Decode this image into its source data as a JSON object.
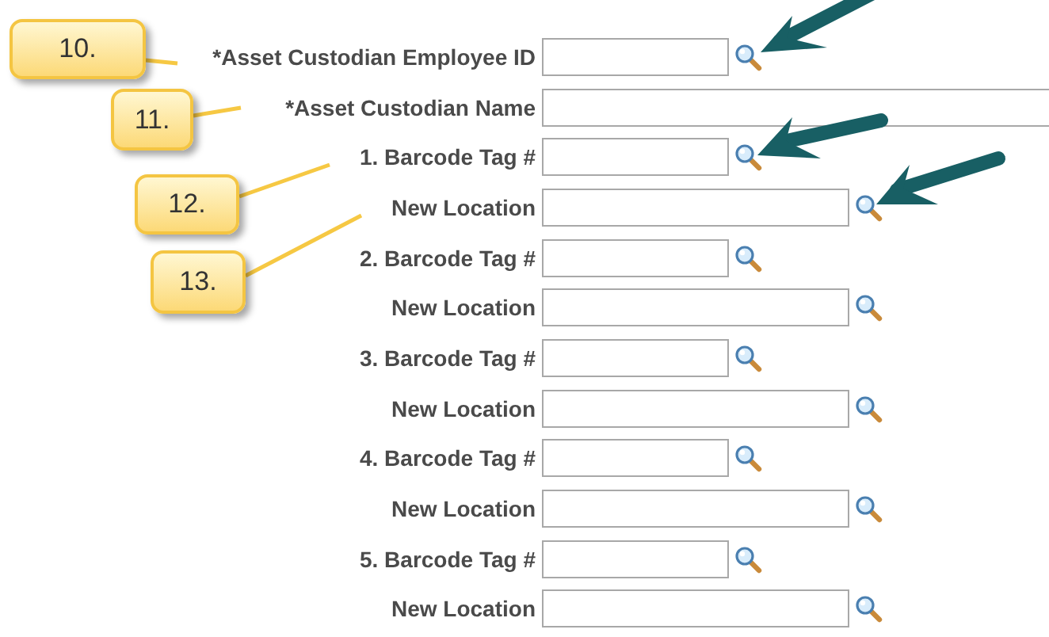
{
  "form": {
    "rows": [
      {
        "label": "*Asset Custodian Employee ID",
        "kind": "short",
        "lookup": true
      },
      {
        "label": "*Asset Custodian Name",
        "kind": "wide",
        "lookup": false
      },
      {
        "label": "1. Barcode Tag #",
        "kind": "short",
        "lookup": true
      },
      {
        "label": "New Location",
        "kind": "long",
        "lookup": true
      },
      {
        "label": "2. Barcode Tag #",
        "kind": "short",
        "lookup": true
      },
      {
        "label": "New Location",
        "kind": "long",
        "lookup": true
      },
      {
        "label": "3. Barcode Tag #",
        "kind": "short",
        "lookup": true
      },
      {
        "label": "New Location",
        "kind": "long",
        "lookup": true
      },
      {
        "label": "4. Barcode Tag #",
        "kind": "short",
        "lookup": true
      },
      {
        "label": "New Location",
        "kind": "long",
        "lookup": true
      },
      {
        "label": "5. Barcode Tag #",
        "kind": "short",
        "lookup": true
      },
      {
        "label": "New Location",
        "kind": "long",
        "lookup": true
      }
    ]
  },
  "callouts": [
    {
      "text": "10."
    },
    {
      "text": "11."
    },
    {
      "text": "12."
    },
    {
      "text": "13."
    }
  ]
}
